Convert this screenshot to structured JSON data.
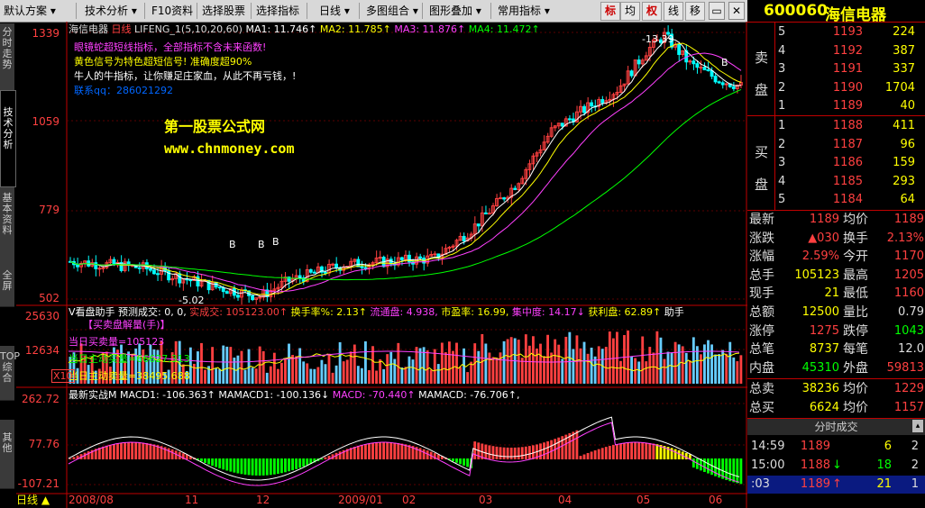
{
  "toolbar": {
    "items": [
      "默认方案",
      "技术分析",
      "F10资料",
      "选择股票",
      "选择指标",
      "日线",
      "多图组合",
      "图形叠加",
      "常用指标"
    ],
    "modes": [
      "标",
      "均",
      "权",
      "线",
      "移"
    ]
  },
  "left_tabs": [
    "分时走势",
    "技术分析",
    "基本资料",
    "全屏",
    "TOP综合",
    "其他"
  ],
  "main_header": {
    "stock": "海信电器",
    "period": "日线",
    "formula": "LIFENG_1(5,10,20,60)",
    "ma1": "MA1: 11.746↑",
    "ma2": "MA2: 11.785↑",
    "ma3": "MA3: 11.876↑",
    "ma4": "MA4: 11.472↑"
  },
  "overlay": {
    "line1": "眼镜蛇超短线指标，全部指标不含未来函数!",
    "line2": "黄色信号为特色超短信号! 准确度超90%",
    "line3": "牛人的牛指标，让你赚足庄家血，从此不再亏钱，!",
    "line4": "联系qq：286021292",
    "watermark1": "第一股票公式网",
    "watermark2": "www.chnmoney.com",
    "high_label": "13.39",
    "low_label": "5.02",
    "b_marks": [
      "B",
      "B",
      "B",
      "B"
    ]
  },
  "price_axis": [
    "1339",
    "1059",
    "779",
    "502"
  ],
  "volume_header": {
    "name": "V看盘助手",
    "fields": "预测成交: 0, 0,",
    "actual": "实成交: 105123.00↑",
    "turnover": "换手率%: 2.13↑",
    "float": "流通盘: 4.938,",
    "pe": "市盈率: 16.99,",
    "concentration": "集中度: 14.17↓",
    "profit": "获利盘: 62.89↑",
    "more": "助手"
  },
  "volume_notes": {
    "title": "【买卖盘解量(手)】",
    "buy": "当日买卖量=105123",
    "active": "当日主动买量=66627.313",
    "passive": "当日主动卖量=38495.688",
    "x10": "X10"
  },
  "volume_axis": [
    "25630",
    "12634"
  ],
  "macd_header": {
    "name": "最新实战M",
    "macd1": "MACD1: -106.363↑",
    "mamacd1": "MAMACD1: -100.136↓",
    "macd": "MACD: -70.440↑",
    "mamacd": "MAMACD: -76.706↑,"
  },
  "macd_axis": [
    "262.72",
    "77.76",
    "-107.21"
  ],
  "date_axis": {
    "period_tab": "日线",
    "labels": [
      "2008/08",
      "11",
      "12",
      "2009/01",
      "02",
      "03",
      "04",
      "05",
      "06"
    ]
  },
  "quote": {
    "code": "600060",
    "name": "海信电器",
    "sell_label": "卖盘",
    "buy_label": "买盘",
    "asks": [
      {
        "lvl": "5",
        "price": "1193",
        "vol": "224"
      },
      {
        "lvl": "4",
        "price": "1192",
        "vol": "387"
      },
      {
        "lvl": "3",
        "price": "1191",
        "vol": "337"
      },
      {
        "lvl": "2",
        "price": "1190",
        "vol": "1704"
      },
      {
        "lvl": "1",
        "price": "1189",
        "vol": "40"
      }
    ],
    "bids": [
      {
        "lvl": "1",
        "price": "1188",
        "vol": "411"
      },
      {
        "lvl": "2",
        "price": "1187",
        "vol": "96"
      },
      {
        "lvl": "3",
        "price": "1186",
        "vol": "159"
      },
      {
        "lvl": "4",
        "price": "1185",
        "vol": "293"
      },
      {
        "lvl": "5",
        "price": "1184",
        "vol": "64"
      }
    ],
    "stats": [
      {
        "l1": "最新",
        "v1": "1189",
        "l2": "均价",
        "v2": "1189"
      },
      {
        "l1": "涨跌",
        "v1": "▲030",
        "l2": "换手",
        "v2": "2.13%"
      },
      {
        "l1": "涨幅",
        "v1": "2.59%",
        "l2": "今开",
        "v2": "1170"
      },
      {
        "l1": "总手",
        "v1": "105123",
        "l2": "最高",
        "v2": "1205"
      },
      {
        "l1": "现手",
        "v1": "21",
        "l2": "最低",
        "v2": "1160"
      },
      {
        "l1": "总额",
        "v1": "12500",
        "l2": "量比",
        "v2": "0.79"
      },
      {
        "l1": "涨停",
        "v1": "1275",
        "l2": "跌停",
        "v2": "1043"
      },
      {
        "l1": "总笔",
        "v1": "8737",
        "l2": "每笔",
        "v2": "12.0"
      },
      {
        "l1": "内盘",
        "v1": "45310",
        "l2": "外盘",
        "v2": "59813"
      }
    ],
    "summary": [
      {
        "l1": "总卖",
        "v1": "38236",
        "l2": "均价",
        "v2": "1229"
      },
      {
        "l1": "总买",
        "v1": "6624",
        "l2": "均价",
        "v2": "1157"
      }
    ],
    "ticks_title": "分时成交",
    "ticks": [
      {
        "time": "14:59",
        "price": "1189",
        "vol": "6",
        "n": "2",
        "arrow": ""
      },
      {
        "time": "15:00",
        "price": "1188",
        "vol": "18",
        "n": "2",
        "arrow": "↓"
      },
      {
        "time": ":03",
        "price": "1189",
        "vol": "21",
        "n": "1",
        "arrow": "↑"
      }
    ]
  },
  "colors": {
    "up": "#ff4040",
    "down": "#00ffff",
    "yellow": "#ffff00",
    "green": "#00ff00",
    "magenta": "#ff40ff",
    "white": "#ffffff"
  }
}
